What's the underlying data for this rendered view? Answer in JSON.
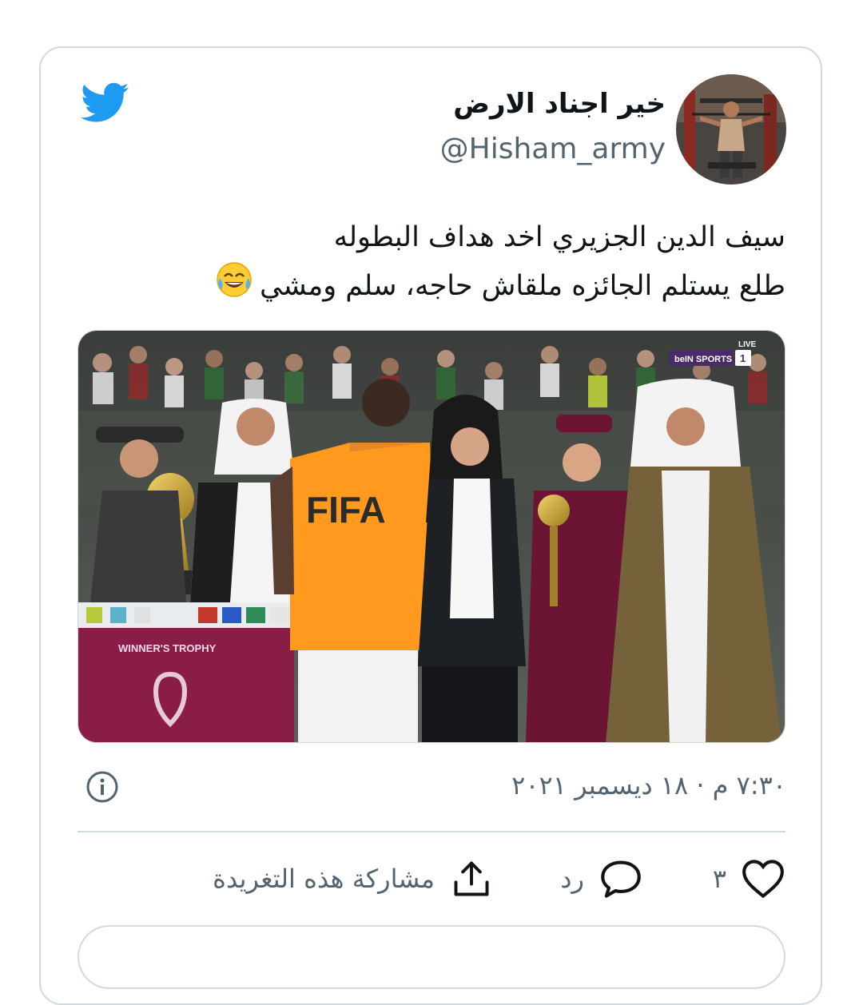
{
  "tweet": {
    "display_name": "خير اجناد الارض",
    "handle": "@Hisham_army",
    "text_lines": [
      "سيف الدين الجزيري اخد هداف البطوله",
      "طلع يستلم الجائزه ملقاش حاجه، سلم ومشي"
    ],
    "emoji": "face-with-tears-of-joy",
    "timestamp": "٧:٣٠ م · ١٨ ديسمبر ٢٠٢١"
  },
  "media": {
    "overlay_winner_label": "WINNER'S TROPHY",
    "bib_text": "FIFA",
    "broadcaster": "beIN SPORTS",
    "broadcaster_channel": "1",
    "live_label": "LIVE"
  },
  "actions": {
    "like_count": "٣",
    "reply_label": "رد",
    "share_label": "مشاركة هذه التغريدة"
  },
  "colors": {
    "twitter_blue": "#1d9bf0",
    "text_primary": "#0f1419",
    "text_secondary": "#536471",
    "border": "#cfd9de"
  },
  "icons": [
    "twitter-logo-icon",
    "info-icon",
    "heart-icon",
    "reply-bubble-icon",
    "share-icon"
  ]
}
